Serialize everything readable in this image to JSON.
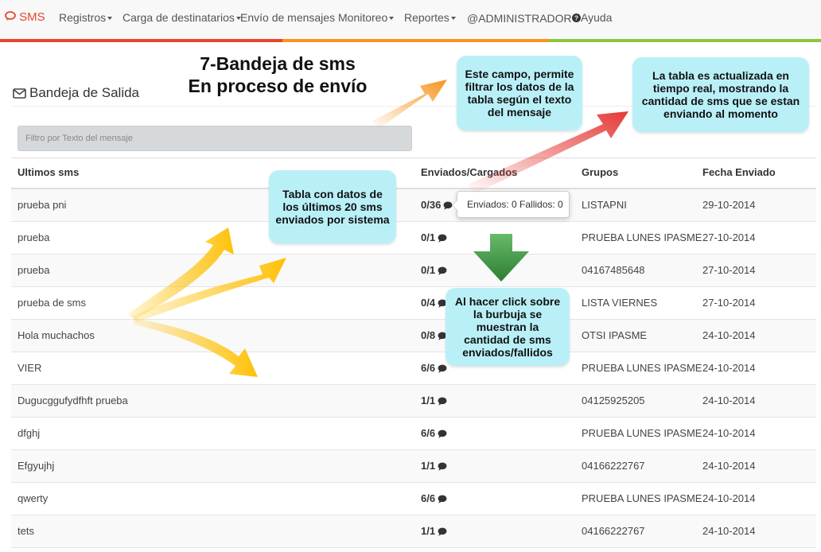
{
  "navbar": {
    "brand": "SMS",
    "items": [
      {
        "label": "Registros",
        "dropdown": true
      },
      {
        "label": "Carga de destinatarios",
        "dropdown": true
      },
      {
        "label": "Envío de mensajes",
        "dropdown": false
      },
      {
        "label": "Monitoreo",
        "dropdown": true
      },
      {
        "label": "Reportes",
        "dropdown": true
      },
      {
        "label": "@ADMINISTRADOR",
        "dropdown": false
      },
      {
        "label": "Ayuda",
        "dropdown": false
      }
    ],
    "stripe_colors": [
      "#e8452c",
      "#f7941d",
      "#8cc63f"
    ]
  },
  "page": {
    "title": "Bandeja de Salida",
    "filter_placeholder": "Filtro por Texto del mensaje"
  },
  "table": {
    "headers": [
      "Ultimos sms",
      "Enviados/Cargados",
      "Grupos",
      "Fecha Enviado"
    ],
    "rows": [
      {
        "msg": "prueba pni",
        "count": "0/36",
        "group": "LISTAPNI",
        "date": "29-10-2014"
      },
      {
        "msg": "prueba",
        "count": "0/1",
        "group": "PRUEBA LUNES IPASME",
        "date": "27-10-2014"
      },
      {
        "msg": "prueba",
        "count": "0/1",
        "group": "04167485648",
        "date": "27-10-2014"
      },
      {
        "msg": "prueba de sms",
        "count": "0/4",
        "group": "LISTA VIERNES",
        "date": "27-10-2014"
      },
      {
        "msg": "Hola muchachos",
        "count": "0/8",
        "group": "OTSI IPASME",
        "date": "24-10-2014"
      },
      {
        "msg": "VIER",
        "count": "6/6",
        "group": "PRUEBA LUNES IPASME",
        "date": "24-10-2014"
      },
      {
        "msg": "Dugucggufydfhft prueba",
        "count": "1/1",
        "group": "04125925205",
        "date": "24-10-2014"
      },
      {
        "msg": "dfghj",
        "count": "6/6",
        "group": "PRUEBA LUNES IPASME",
        "date": "24-10-2014"
      },
      {
        "msg": "Efgyujhj",
        "count": "1/1",
        "group": "04166222767",
        "date": "24-10-2014"
      },
      {
        "msg": "qwerty",
        "count": "6/6",
        "group": "PRUEBA LUNES IPASME",
        "date": "24-10-2014"
      },
      {
        "msg": "tets",
        "count": "1/1",
        "group": "04166222767",
        "date": "24-10-2014"
      }
    ]
  },
  "tooltip": "Enviados: 0 Fallidos: 0",
  "annotations": {
    "title_line1": "7-Bandeja de sms",
    "title_line2": "En proceso de envío",
    "filter_note": "Este campo, permite filtrar los datos de la tabla según el texto del mensaje",
    "realtime_note": "La tabla es actualizada en tiempo real, mostrando la cantidad de sms que se estan enviando al momento",
    "table_note": "Tabla con datos de los últimos 20 sms enviados por sistema",
    "bubble_note": "Al hacer click sobre la burbuja se muestran la cantidad de sms enviados/fallidos",
    "callout_color": "#b9f0f8",
    "arrow_colors": {
      "orange": "#f7941d",
      "red": "#e53935",
      "yellow": "#ffc107",
      "green": "#43a047"
    }
  }
}
